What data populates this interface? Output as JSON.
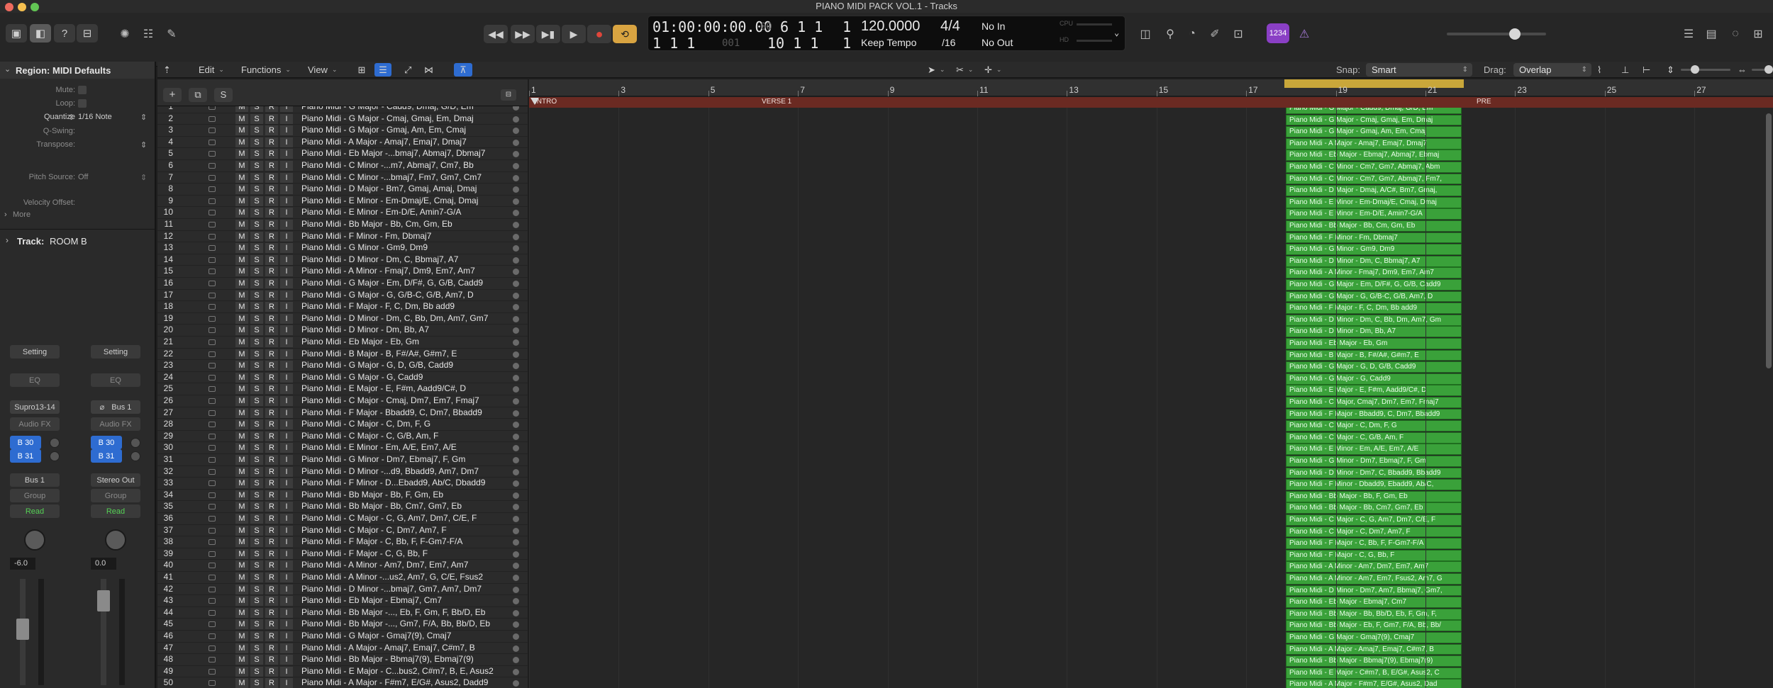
{
  "window": {
    "title": "PIANO MIDI PACK VOL.1 - Tracks"
  },
  "colors": {
    "region_green": "#3aa13a",
    "cycle_yellow": "#c9a73a",
    "marker_red": "#6b2a22",
    "accent_blue": "#2e6cd1",
    "record_red": "#e0463b",
    "cycle_btn": "#d9a441"
  },
  "transport": {
    "time_code": "01:00:00:00.00",
    "time_code_sub": "00",
    "bars_top": "6 1 1",
    "bars_top_sub": "1",
    "bars_pos": "1 1 1",
    "bars_pos_sub": "001",
    "bars_right": "10 1 1",
    "bars_right_sub": "1",
    "tempo": "120.0000",
    "tempo_mode": "Keep Tempo",
    "signature": "4/4",
    "division": "/16",
    "midi_in": "No In",
    "midi_out": "No Out",
    "cpu_label": "CPU",
    "hd_label": "HD",
    "badge": "1234"
  },
  "edit_menu": {
    "edit": "Edit",
    "functions": "Functions",
    "view": "View"
  },
  "snap": {
    "label": "Snap:",
    "value": "Smart"
  },
  "drag": {
    "label": "Drag:",
    "value": "Overlap"
  },
  "inspector": {
    "region_title": "Region: MIDI Defaults",
    "mute": "Mute:",
    "loop": "Loop:",
    "quantize_label": "Quantize",
    "quantize_value": "1/16 Note",
    "qswing": "Q-Swing:",
    "transpose": "Transpose:",
    "pitch_source_label": "Pitch Source:",
    "pitch_source_value": "Off",
    "velocity_offset": "Velocity Offset:",
    "more": "More",
    "track_label": "Track:",
    "track_name": "ROOM B",
    "strip1": {
      "setting": "Setting",
      "eq": "EQ",
      "name": "Supro13-14",
      "fx": "Audio FX",
      "send1": "B 30",
      "send2": "B 31",
      "output": "Bus 1",
      "group": "Group",
      "automation": "Read",
      "volume": "-6.0"
    },
    "strip2": {
      "setting": "Setting",
      "eq": "EQ",
      "name": "Bus 1",
      "link": "⌀",
      "fx": "Audio FX",
      "send1": "B 30",
      "send2": "B 31",
      "output": "Stereo Out",
      "group": "Group",
      "automation": "Read",
      "volume": "0.0"
    }
  },
  "track_buttons": {
    "m": "M",
    "s": "S",
    "r": "R",
    "i": "I"
  },
  "ruler_marks": [
    "1",
    "3",
    "5",
    "7",
    "9",
    "11",
    "13",
    "15",
    "17",
    "19",
    "21",
    "23",
    "25",
    "27"
  ],
  "markers": [
    {
      "label": "INTRO"
    },
    {
      "label": "VERSE 1"
    },
    {
      "label": "PRE"
    }
  ],
  "tracks": [
    {
      "num": "1",
      "name": "Piano Midi - G Major - Cadd9, Dmaj, G/D, Em",
      "region": "Piano Midi - G Major - Cadd9, Dmaj, G/D, Em"
    },
    {
      "num": "2",
      "name": "Piano Midi - G Major - Cmaj, Gmaj, Em, Dmaj",
      "region": "Piano Midi - G Major - Cmaj, Gmaj, Em, Dmaj"
    },
    {
      "num": "3",
      "name": "Piano Midi - G Major - Gmaj, Am, Em, Cmaj",
      "region": "Piano Midi - G Major - Gmaj, Am, Em, Cmaj"
    },
    {
      "num": "4",
      "name": "Piano Midi - A Major - Amaj7, Emaj7, Dmaj7",
      "region": "Piano Midi - A Major - Amaj7, Emaj7, Dmaj7"
    },
    {
      "num": "5",
      "name": "Piano Midi - Eb Major -...bmaj7, Abmaj7, Dbmaj7",
      "region": "Piano Midi - Eb Major - Ebmaj7, Abmaj7, Ebmaj"
    },
    {
      "num": "6",
      "name": "Piano Midi - C Minor -...m7, Abmaj7, Cm7, Bb",
      "region": "Piano Midi - C Minor - Cm7, Gm7, Abmaj7, Abm"
    },
    {
      "num": "7",
      "name": "Piano Midi - C Minor -...bmaj7, Fm7, Gm7, Cm7",
      "region": "Piano Midi - C Minor - Cm7, Gm7, Abmaj7, Fm7,"
    },
    {
      "num": "8",
      "name": "Piano Midi - D Major - Bm7, Gmaj, Amaj, Dmaj",
      "region": "Piano Midi - D Major - Dmaj, A/C#, Bm7, Gmaj,"
    },
    {
      "num": "9",
      "name": "Piano Midi - E Minor - Em-Dmaj/E, Cmaj, Dmaj",
      "region": "Piano Midi - E Minor - Em-Dmaj/E, Cmaj, Dmaj"
    },
    {
      "num": "10",
      "name": "Piano Midi - E Minor - Em-D/E, Amin7-G/A",
      "region": "Piano Midi - E Minor - Em-D/E, Amin7-G/A"
    },
    {
      "num": "11",
      "name": "Piano Midi - Bb Major - Bb, Cm, Gm, Eb",
      "region": "Piano Midi - Bb Major - Bb, Cm, Gm, Eb"
    },
    {
      "num": "12",
      "name": "Piano Midi - F Minor - Fm, Dbmaj7",
      "region": "Piano Midi - F Minor - Fm, Dbmaj7"
    },
    {
      "num": "13",
      "name": "Piano Midi - G Minor - Gm9, Dm9",
      "region": "Piano Midi - G Minor - Gm9, Dm9"
    },
    {
      "num": "14",
      "name": "Piano Midi - D Minor - Dm, C, Bbmaj7, A7",
      "region": "Piano Midi - D Minor - Dm, C, Bbmaj7, A7"
    },
    {
      "num": "15",
      "name": "Piano Midi - A Minor - Fmaj7, Dm9, Em7, Am7",
      "region": "Piano Midi - A Minor - Fmaj7, Dm9, Em7, Am7"
    },
    {
      "num": "16",
      "name": "Piano Midi - G Major - Em, D/F#, G, G/B, Cadd9",
      "region": "Piano Midi - G Major - Em, D/F#, G, G/B, Cadd9"
    },
    {
      "num": "17",
      "name": "Piano Midi - G Major - G, G/B-C, G/B, Am7, D",
      "region": "Piano Midi - G Major - G, G/B-C, G/B, Am7, D"
    },
    {
      "num": "18",
      "name": "Piano Midi - F Major - F, C, Dm, Bb add9",
      "region": "Piano Midi - F Major - F, C, Dm, Bb add9"
    },
    {
      "num": "19",
      "name": "Piano Midi - D Minor - Dm, C, Bb, Dm, Am7, Gm7",
      "region": "Piano Midi - D Minor - Dm, C, Bb, Dm, Am7, Gm"
    },
    {
      "num": "20",
      "name": "Piano Midi - D Minor - Dm, Bb, A7",
      "region": "Piano Midi - D Minor - Dm, Bb, A7"
    },
    {
      "num": "21",
      "name": "Piano Midi - Eb Major - Eb, Gm",
      "region": "Piano Midi - Eb Major - Eb, Gm"
    },
    {
      "num": "22",
      "name": "Piano Midi - B Major - B, F#/A#, G#m7, E",
      "region": "Piano Midi - B Major - B, F#/A#, G#m7, E"
    },
    {
      "num": "23",
      "name": "Piano Midi - G Major - G, D, G/B, Cadd9",
      "region": "Piano Midi - G Major - G, D, G/B, Cadd9"
    },
    {
      "num": "24",
      "name": "Piano Midi - G Major - G, Cadd9",
      "region": "Piano Midi - G Major - G, Cadd9"
    },
    {
      "num": "25",
      "name": "Piano Midi - E Major - E, F#m, Aadd9/C#, D",
      "region": "Piano Midi - E Major - E, F#m, Aadd9/C#, D"
    },
    {
      "num": "26",
      "name": "Piano Midi - C Major - Cmaj, Dm7, Em7, Fmaj7",
      "region": "Piano Midi - C Major, Cmaj7, Dm7, Em7, Fmaj7"
    },
    {
      "num": "27",
      "name": "Piano Midi - F Major - Bbadd9, C, Dm7, Bbadd9",
      "region": "Piano Midi - F Major - Bbadd9, C, Dm7, Bbadd9"
    },
    {
      "num": "28",
      "name": "Piano Midi - C Major - C, Dm, F, G",
      "region": "Piano Midi - C Major - C, Dm, F, G"
    },
    {
      "num": "29",
      "name": "Piano Midi - C Major - C, G/B, Am, F",
      "region": "Piano Midi - C Major - C, G/B, Am, F"
    },
    {
      "num": "30",
      "name": "Piano Midi - E Minor - Em, A/E, Em7, A/E",
      "region": "Piano Midi - E Minor - Em, A/E, Em7, A/E"
    },
    {
      "num": "31",
      "name": "Piano Midi - G Minor - Dm7, Ebmaj7, F, Gm",
      "region": "Piano Midi - G Minor - Dm7, Ebmaj7, F, Gm"
    },
    {
      "num": "32",
      "name": "Piano Midi - D Minor -...d9, Bbadd9, Am7, Dm7",
      "region": "Piano Midi - D Minor - Dm7, C, Bbadd9, Bbadd9"
    },
    {
      "num": "33",
      "name": "Piano Midi - F Minor - D...Ebadd9, Ab/C, Dbadd9",
      "region": "Piano Midi - F Minor - Dbadd9, Ebadd9, Ab/C,"
    },
    {
      "num": "34",
      "name": "Piano Midi - Bb Major - Bb, F, Gm, Eb",
      "region": "Piano Midi - Bb Major - Bb, F, Gm, Eb"
    },
    {
      "num": "35",
      "name": "Piano Midi - Bb Major - Bb, Cm7, Gm7, Eb",
      "region": "Piano Midi - Bb Major - Bb, Cm7, Gm7, Eb"
    },
    {
      "num": "36",
      "name": "Piano Midi - C Major - C, G, Am7, Dm7, C/E, F",
      "region": "Piano Midi - C Major - C, G, Am7, Dm7, C/E, F"
    },
    {
      "num": "37",
      "name": "Piano Midi - C Major - C, Dm7, Am7, F",
      "region": "Piano Midi - C Major - C, Dm7, Am7, F"
    },
    {
      "num": "38",
      "name": "Piano Midi - F Major - C, Bb, F, F-Gm7-F/A",
      "region": "Piano Midi - F Major - C, Bb, F, F-Gm7-F/A"
    },
    {
      "num": "39",
      "name": "Piano Midi - F Major - C, G, Bb, F",
      "region": "Piano Midi - F Major - C, G, Bb, F"
    },
    {
      "num": "40",
      "name": "Piano Midi - A Minor - Am7, Dm7, Em7, Am7",
      "region": "Piano Midi - A Minor - Am7, Dm7, Em7, Am7"
    },
    {
      "num": "41",
      "name": "Piano Midi - A Minor -...us2, Am7, G, C/E, Fsus2",
      "region": "Piano Midi - A Minor - Am7, Em7, Fsus2, Am7, G"
    },
    {
      "num": "42",
      "name": "Piano Midi - D Minor -...bmaj7, Gm7, Am7, Dm7",
      "region": "Piano Midi - D Minor - Dm7, Am7, Bbmaj7, Gm7,"
    },
    {
      "num": "43",
      "name": "Piano Midi - Eb Major - Ebmaj7, Cm7",
      "region": "Piano Midi - Eb Major - Ebmaj7, Cm7"
    },
    {
      "num": "44",
      "name": "Piano Midi - Bb Major -..., Eb, F, Gm, F, Bb/D, Eb",
      "region": "Piano Midi - Bb Major - Bb, Bb/D, Eb, F, Gm, F,"
    },
    {
      "num": "45",
      "name": "Piano Midi - Bb Major -..., Gm7, F/A, Bb, Bb/D, Eb",
      "region": "Piano Midi - Bb Major - Eb, F, Gm7, F/A, Bb, Bb/"
    },
    {
      "num": "46",
      "name": "Piano Midi - G Major - Gmaj7(9), Cmaj7",
      "region": "Piano Midi - G Major - Gmaj7(9), Cmaj7"
    },
    {
      "num": "47",
      "name": "Piano Midi - A Major - Amaj7, Emaj7, C#m7, B",
      "region": "Piano Midi - A Major - Amaj7, Emaj7, C#m7, B"
    },
    {
      "num": "48",
      "name": "Piano Midi - Bb Major - Bbmaj7(9), Ebmaj7(9)",
      "region": "Piano Midi - Bb Major - Bbmaj7(9), Ebmaj7(9)"
    },
    {
      "num": "49",
      "name": "Piano Midi - E Major - C...bus2, C#m7, B, E, Asus2",
      "region": "Piano Midi - E Major - C#m7, B, E/G#, Asus2, C"
    },
    {
      "num": "50",
      "name": "Piano Midi - A Major - F#m7, E/G#, Asus2, Dadd9",
      "region": "Piano Midi - A Major - F#m7, E/G#, Asus2, Dad"
    }
  ]
}
